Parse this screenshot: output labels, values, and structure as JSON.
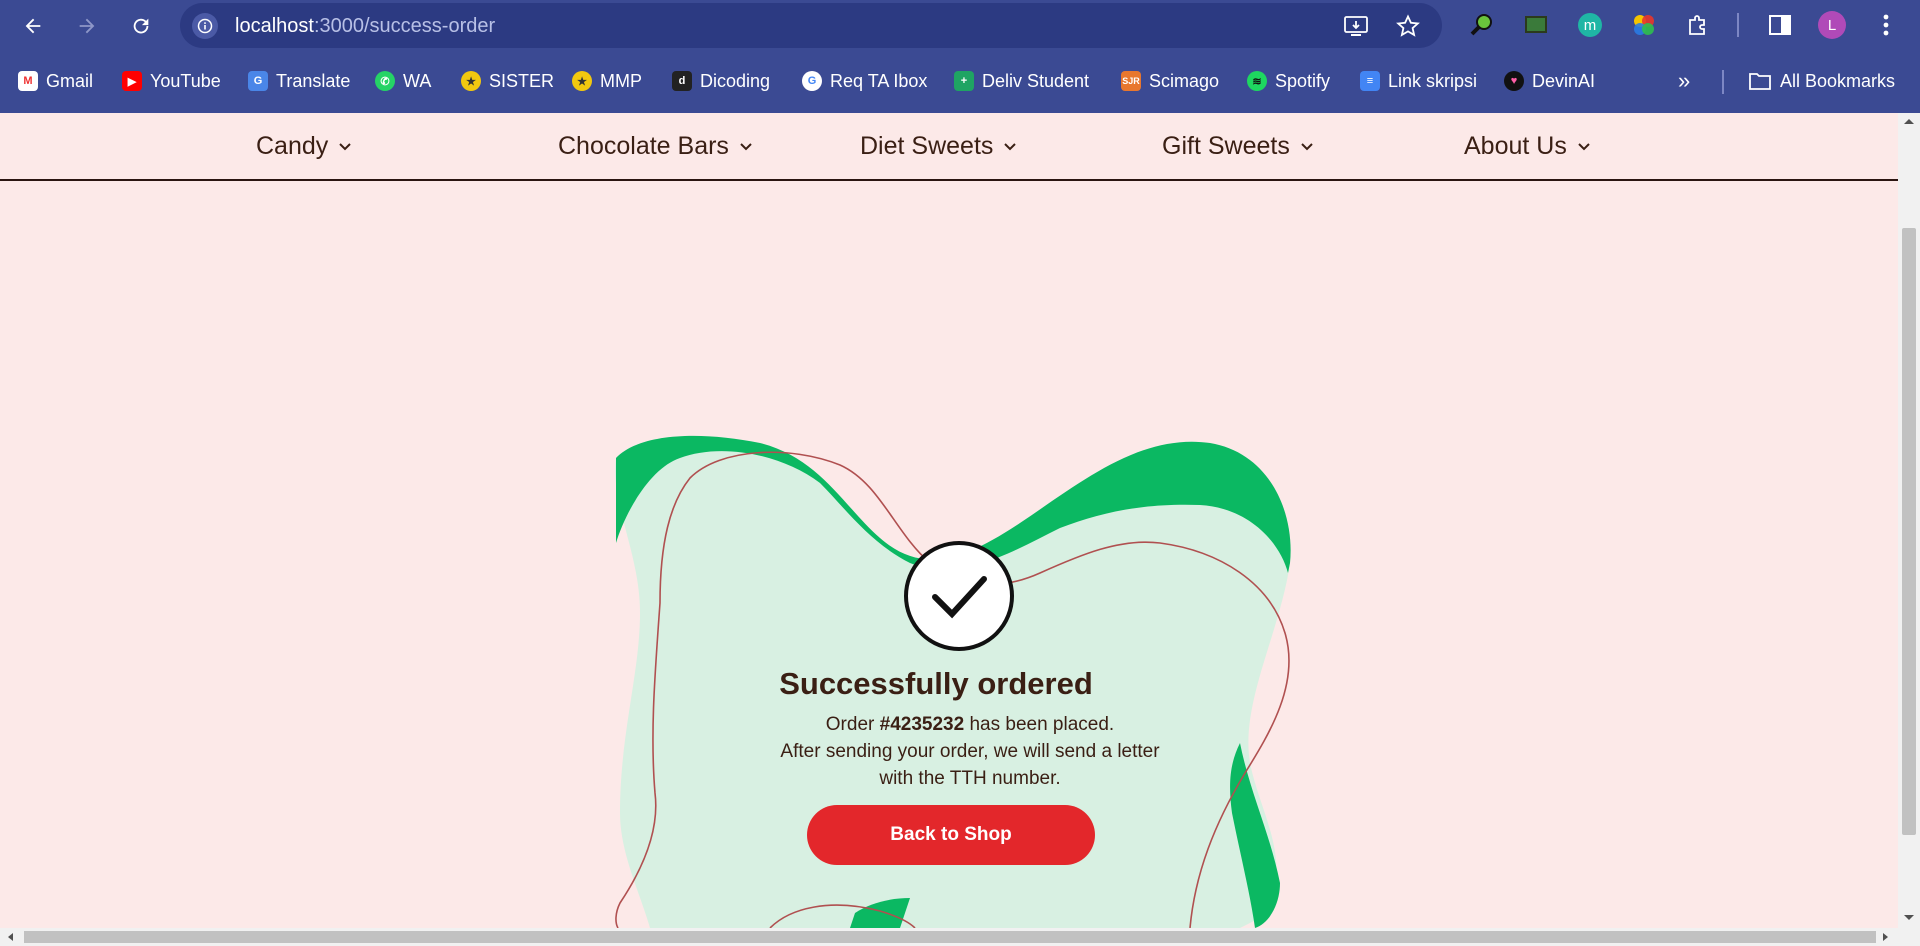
{
  "browser": {
    "url_host": "localhost",
    "url_path": ":3000/success-order",
    "profile_initial": "L",
    "bookmarks": [
      "Gmail",
      "YouTube",
      "Translate",
      "WA",
      "SISTER",
      "MMP",
      "Dicoding",
      "Req TA Ibox",
      "Deliv Student",
      "Scimago",
      "Spotify",
      "Link skripsi",
      "DevinAI"
    ],
    "all_bookmarks_label": "All Bookmarks"
  },
  "nav": {
    "items": [
      "Candy",
      "Chocolate Bars",
      "Diet Sweets",
      "Gift Sweets",
      "About Us"
    ]
  },
  "success": {
    "title": "Successfully ordered",
    "order_prefix": "Order ",
    "order_number": "#4235232",
    "order_suffix": " has been placed.",
    "line2": "After sending your order, we will send a letter",
    "line3": "with the TTH number.",
    "button_label": "Back to Shop"
  },
  "colors": {
    "page_bg": "#fce9e8",
    "blob_green": "#0bb862",
    "blob_light": "#d8f0e2",
    "outline": "#b05050",
    "button": "#e3272b",
    "text": "#3a1f14",
    "browser_bar": "#3b4a93"
  }
}
